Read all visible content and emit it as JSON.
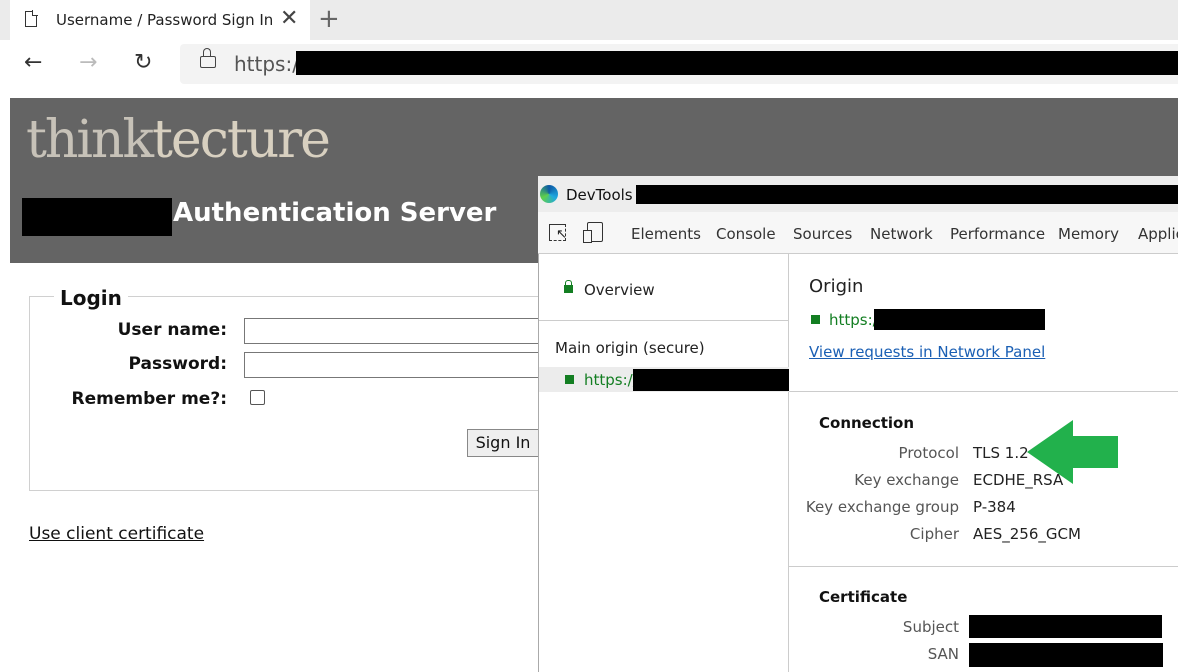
{
  "browser": {
    "tab_title": "Username / Password Sign In",
    "tab_close": "✕",
    "new_tab": "+",
    "back": "←",
    "forward": "→",
    "reload": "↻",
    "url_prefix": "https://"
  },
  "page": {
    "logo_part1": "think",
    "logo_part2": "tecture",
    "title_suffix": "Authentication Server",
    "login": {
      "legend": "Login",
      "username_label": "User name:",
      "password_label": "Password:",
      "remember_label": "Remember me?:",
      "signin_button": "Sign In"
    },
    "client_cert_link": "Use client certificate"
  },
  "devtools": {
    "title_prefix": "DevTools -",
    "tabs": [
      "Elements",
      "Console",
      "Sources",
      "Network",
      "Performance",
      "Memory",
      "Applic"
    ],
    "left": {
      "overview": "Overview",
      "main_origin": "Main origin (secure)",
      "origin_url": "https://"
    },
    "origin": {
      "heading": "Origin",
      "url": "https://",
      "view_requests": "View requests in Network Panel"
    },
    "connection": {
      "heading": "Connection",
      "rows": [
        {
          "key": "Protocol",
          "value": "TLS 1.2"
        },
        {
          "key": "Key exchange",
          "value": "ECDHE_RSA"
        },
        {
          "key": "Key exchange group",
          "value": "P-384"
        },
        {
          "key": "Cipher",
          "value": "AES_256_GCM"
        }
      ]
    },
    "certificate": {
      "heading": "Certificate",
      "rows": [
        {
          "key": "Subject"
        },
        {
          "key": "SAN"
        }
      ]
    }
  },
  "colors": {
    "secure_green": "#137e22",
    "annotation_arrow": "#22b14c",
    "header_bg": "#646464"
  }
}
